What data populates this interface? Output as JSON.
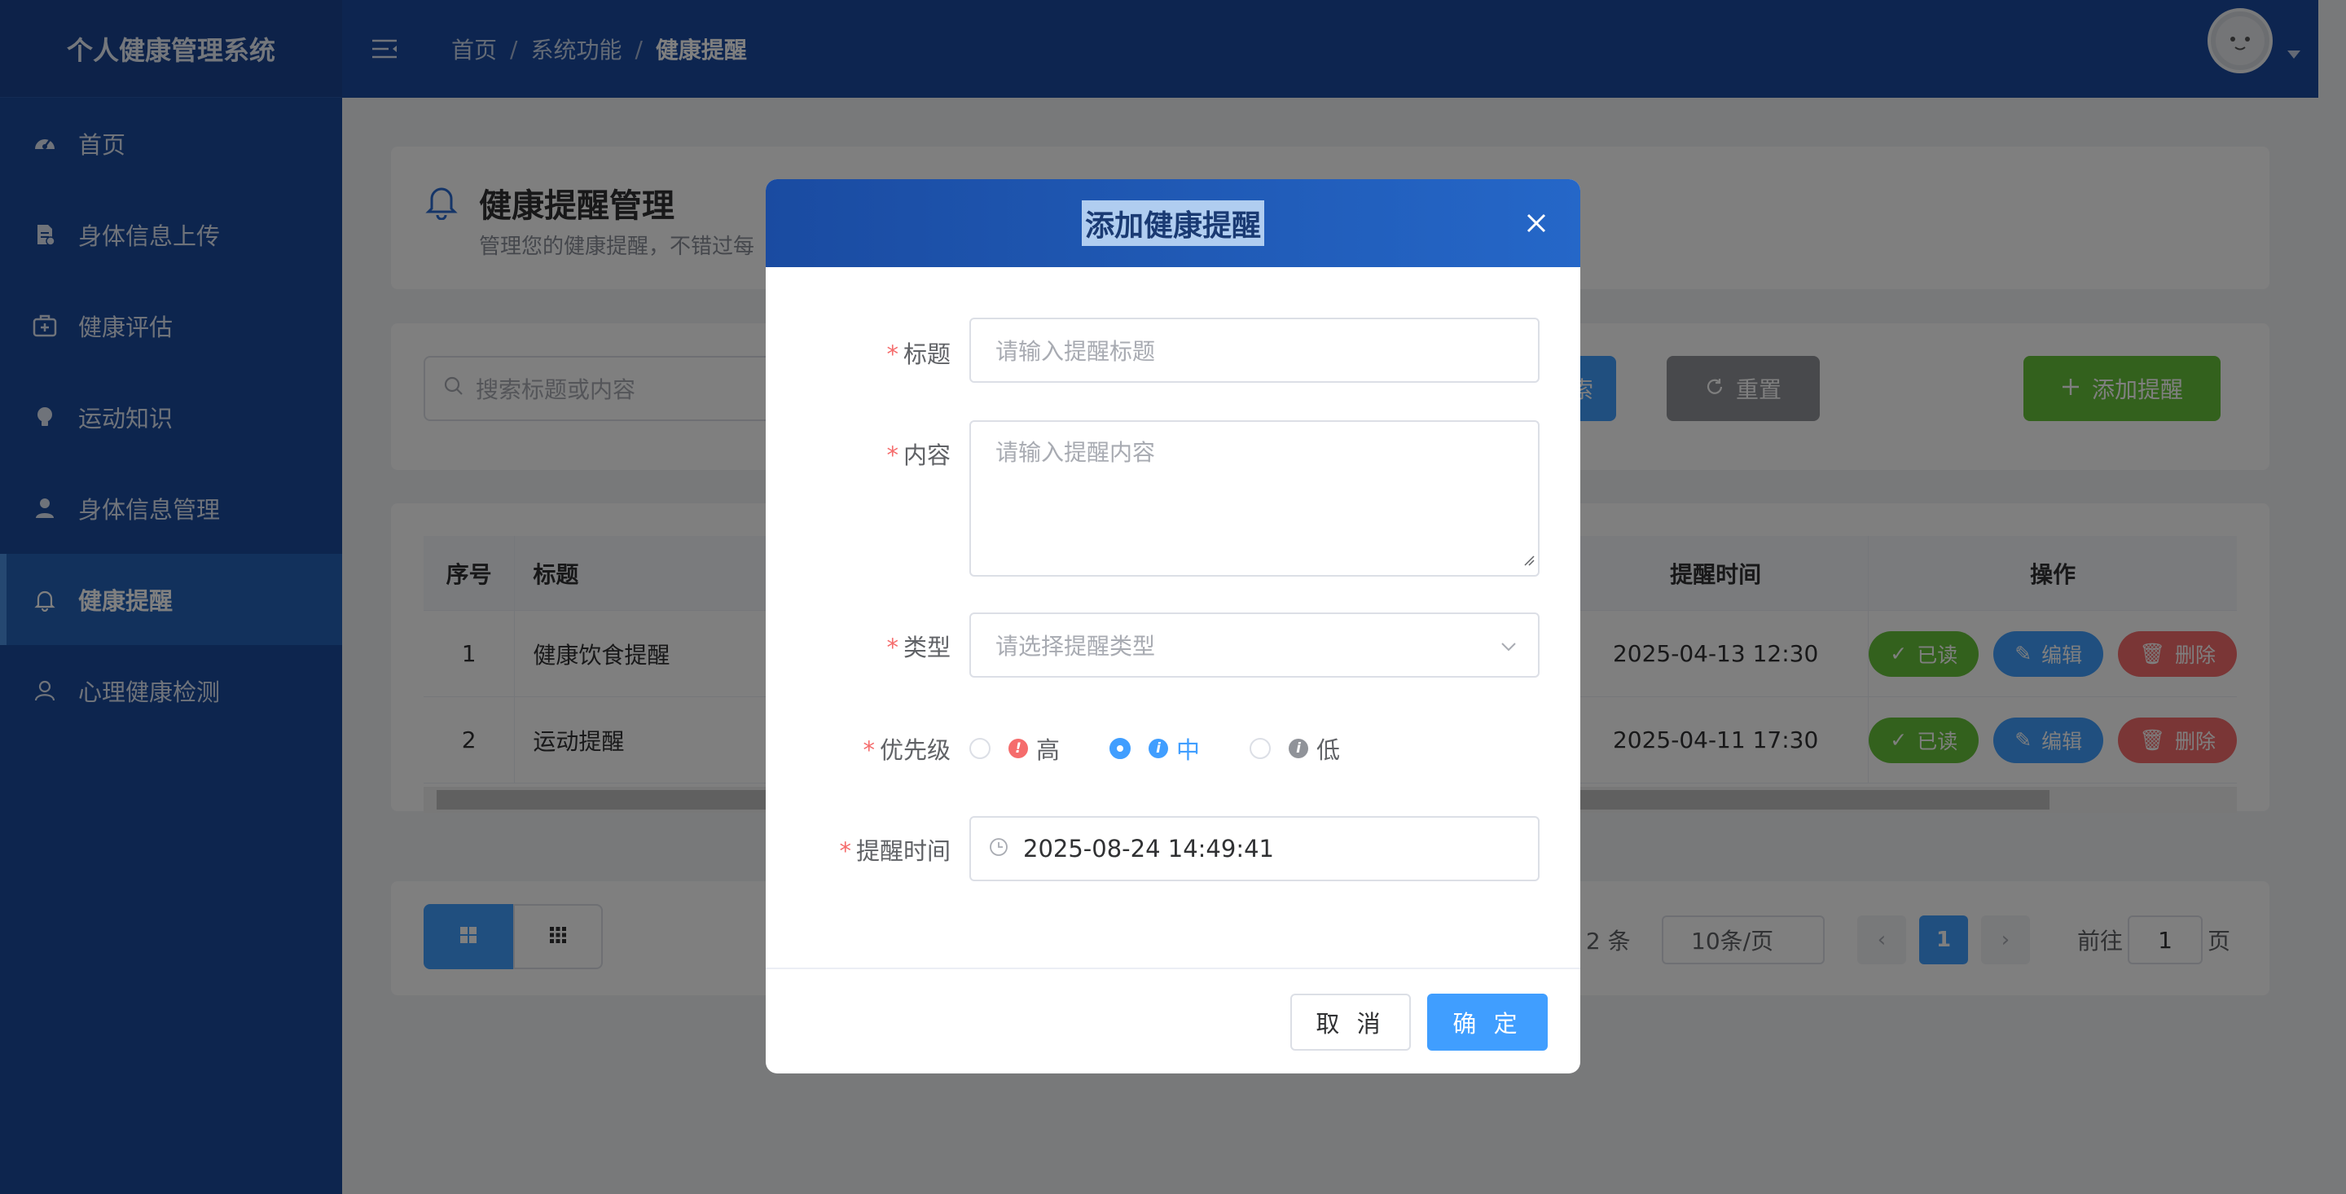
{
  "app": {
    "title": "个人健康管理系统"
  },
  "sidebar": {
    "items": [
      {
        "label": "首页",
        "icon": "dashboard-icon"
      },
      {
        "label": "身体信息上传",
        "icon": "document-upload-icon"
      },
      {
        "label": "健康评估",
        "icon": "medical-kit-icon"
      },
      {
        "label": "运动知识",
        "icon": "lightbulb-icon"
      },
      {
        "label": "身体信息管理",
        "icon": "user-icon"
      },
      {
        "label": "健康提醒",
        "icon": "bell-icon",
        "active": true
      },
      {
        "label": "心理健康检测",
        "icon": "person-outline-icon"
      }
    ]
  },
  "header": {
    "breadcrumb": [
      "首页",
      "系统功能",
      "健康提醒"
    ],
    "separator": "/"
  },
  "page": {
    "title": "健康提醒管理",
    "subtitle": "管理您的健康提醒，不错过每"
  },
  "search": {
    "placeholder": "搜索标题或内容",
    "search_label": "索",
    "reset_label": "重置",
    "add_label": "添加提醒"
  },
  "table": {
    "columns": {
      "index": "序号",
      "title": "标题",
      "time": "提醒时间",
      "ops": "操作"
    },
    "rows": [
      {
        "index": "1",
        "title": "健康饮食提醒",
        "time": "2025-04-13 12:30"
      },
      {
        "index": "2",
        "title": "运动提醒",
        "time": "2025-04-11 17:30"
      }
    ],
    "actions": {
      "read": "已读",
      "edit": "编辑",
      "delete": "删除"
    }
  },
  "pagination": {
    "total": "共 2 条",
    "page_size": "10条/页",
    "current_page": "1",
    "goto_prefix": "前往",
    "goto_value": "1",
    "goto_suffix": "页"
  },
  "dialog": {
    "title": "添加健康提醒",
    "required_mark": "*",
    "fields": {
      "title": {
        "label": "标题",
        "placeholder": "请输入提醒标题"
      },
      "content": {
        "label": "内容",
        "placeholder": "请输入提醒内容"
      },
      "type": {
        "label": "类型",
        "placeholder": "请选择提醒类型"
      },
      "priority": {
        "label": "优先级",
        "options": [
          {
            "label": "高",
            "badge": "!",
            "color": "#f56c6c"
          },
          {
            "label": "中",
            "badge": "i",
            "color": "#409eff",
            "selected": true
          },
          {
            "label": "低",
            "badge": "i",
            "color": "#909399"
          }
        ]
      },
      "remind_time": {
        "label": "提醒时间",
        "value": "2025-08-24 14:49:41"
      }
    },
    "cancel_label": "取 消",
    "confirm_label": "确 定"
  },
  "colors": {
    "primary": "#409eff",
    "success": "#67c23a",
    "danger": "#f56c6c",
    "info": "#909399",
    "sidebar": "#1a4a9c",
    "header": "#1a4ba1"
  }
}
